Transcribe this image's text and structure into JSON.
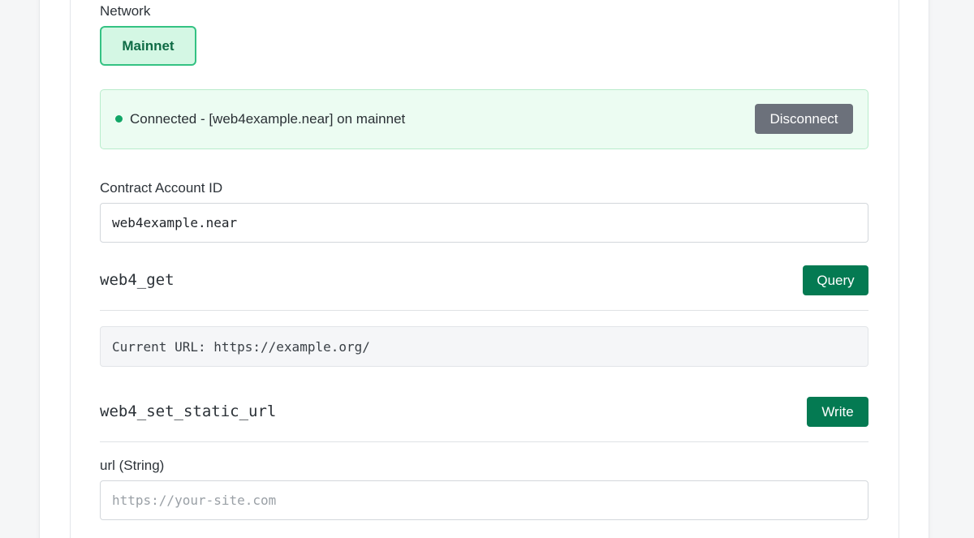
{
  "network": {
    "label": "Network",
    "selected": "Mainnet"
  },
  "status": {
    "text": "Connected - [web4example.near] on mainnet",
    "disconnect_label": "Disconnect",
    "dot_color": "#11a566"
  },
  "contract": {
    "label": "Contract Account ID",
    "value": "web4example.near"
  },
  "methods": {
    "get": {
      "name": "web4_get",
      "button_label": "Query",
      "result": "Current URL: https://example.org/"
    },
    "set_static_url": {
      "name": "web4_set_static_url",
      "button_label": "Write",
      "param_label": "url (String)",
      "param_placeholder": "https://your-site.com"
    }
  },
  "colors": {
    "accent_green": "#047a52",
    "network_selected_bg": "#d4f7e4",
    "network_selected_border": "#34c283",
    "status_bg": "#ecfcf2",
    "disconnect_bg": "#6c717b"
  }
}
